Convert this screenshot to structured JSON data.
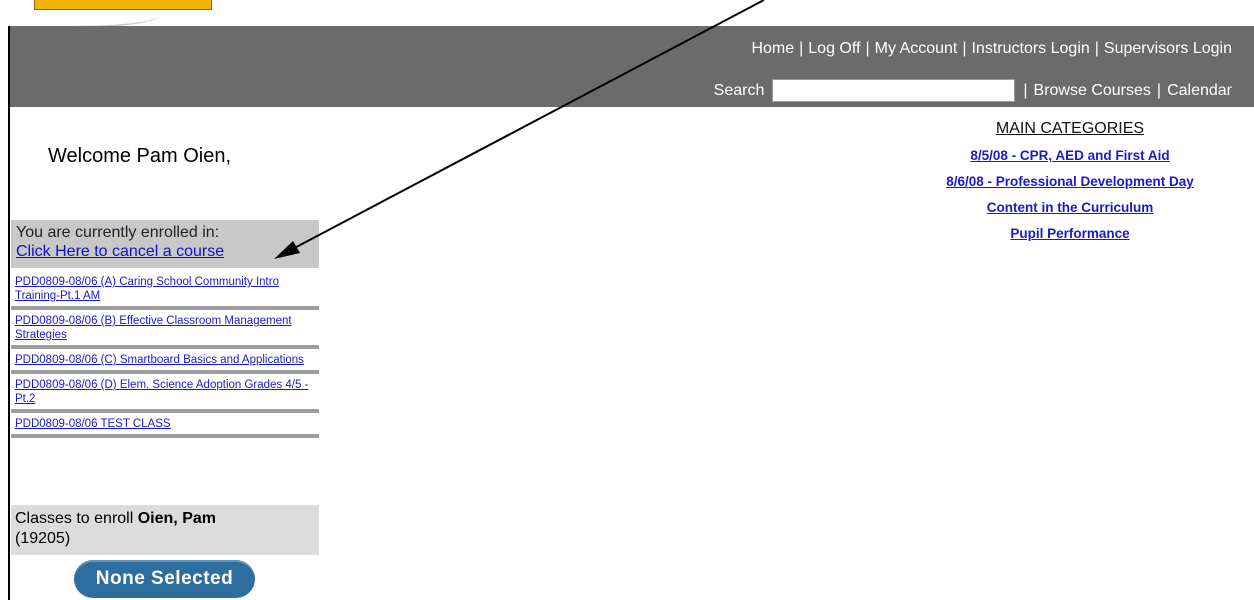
{
  "header": {
    "nav": {
      "home": "Home",
      "log_off": "Log Off",
      "my_account": "My Account",
      "instructors_login": "Instructors Login",
      "supervisors_login": "Supervisors Login",
      "separator": "|"
    },
    "search_label": "Search",
    "search_value": "",
    "browse_courses": "Browse Courses",
    "calendar": "Calendar"
  },
  "welcome": "Welcome Pam Oien,",
  "enrolled": {
    "label": "You are currently enrolled in:",
    "cancel_link": "Click Here to cancel a course",
    "courses": [
      "PDD0809-08/06 (A) Caring School Community Intro Training-Pt.1 AM",
      "PDD0809-08/06 (B) Effective Classroom Management Strategies",
      "PDD0809-08/06 (C) Smartboard Basics and Applications",
      "PDD0809-08/06 (D) Elem. Science Adoption Grades 4/5 - Pt.2",
      "PDD0809-08/06 TEST CLASS"
    ]
  },
  "enroll": {
    "prefix": "Classes to enroll",
    "name": "Oien, Pam",
    "id": "(19205)",
    "button": "None Selected"
  },
  "categories": {
    "title": "MAIN CATEGORIES",
    "items": [
      "8/5/08 - CPR, AED and First Aid",
      "8/6/08 - Professional Development Day",
      "Content in the Curriculum",
      "Pupil Performance"
    ]
  },
  "colors": {
    "header_bg": "#6b6b6b",
    "link": "#1a1acc",
    "button_bg": "#2e6e9e",
    "logo_gold": "#f2b300"
  }
}
